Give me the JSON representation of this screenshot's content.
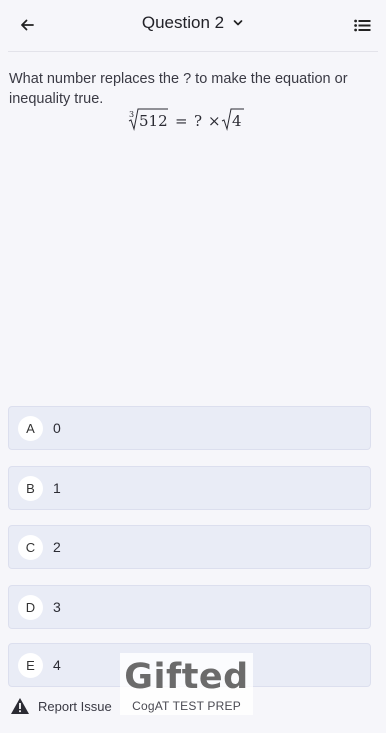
{
  "header": {
    "title": "Question 2",
    "back_icon": "arrow-left-icon",
    "dropdown_icon": "chevron-down-icon",
    "list_icon": "list-icon"
  },
  "question": {
    "prompt": "What number replaces the ? to make the equation or inequality true.",
    "equation": {
      "cube_root_index": "3",
      "radicand_left": "512",
      "equals": "=",
      "unknown": "?",
      "times": "×",
      "radicand_right": "4"
    }
  },
  "options": [
    {
      "letter": "A",
      "value": "0"
    },
    {
      "letter": "B",
      "value": "1"
    },
    {
      "letter": "C",
      "value": "2"
    },
    {
      "letter": "D",
      "value": "3"
    },
    {
      "letter": "E",
      "value": "4"
    }
  ],
  "footer": {
    "report_label": "Report Issue",
    "warning_icon": "warning-icon"
  },
  "watermark": {
    "brand": "Gifted",
    "tagline": "CogAT TEST PREP"
  },
  "colors": {
    "background": "#f6f6fa",
    "option_bg": "#e9ecf6",
    "text": "#2b2b33"
  }
}
